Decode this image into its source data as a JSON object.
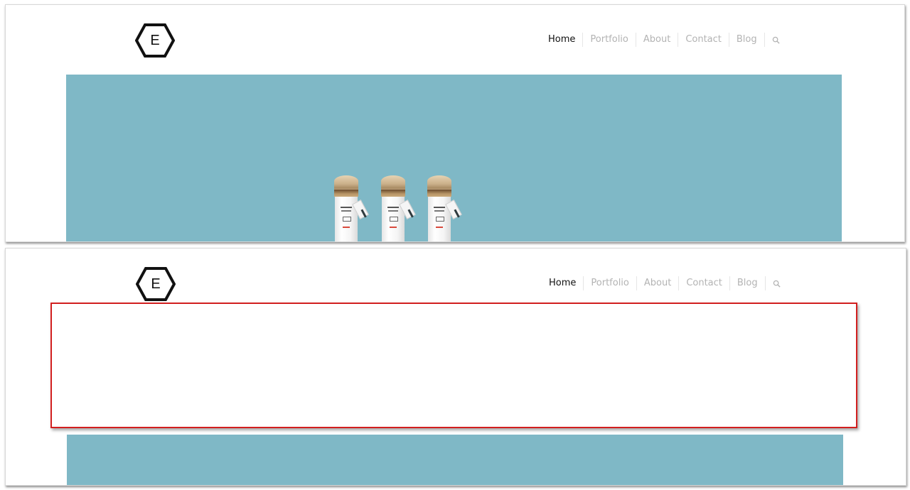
{
  "site": {
    "logo_letter": "E"
  },
  "nav": {
    "items": [
      {
        "label": "Home",
        "active": true
      },
      {
        "label": "Portfolio",
        "active": false
      },
      {
        "label": "About",
        "active": false
      },
      {
        "label": "Contact",
        "active": false
      },
      {
        "label": "Blog",
        "active": false
      }
    ],
    "search_icon": "search-icon"
  },
  "colors": {
    "hero_background": "#7fb8c6",
    "nav_active": "#111111",
    "nav_inactive": "#b3b3b3",
    "highlight_border": "#d21f1f"
  }
}
